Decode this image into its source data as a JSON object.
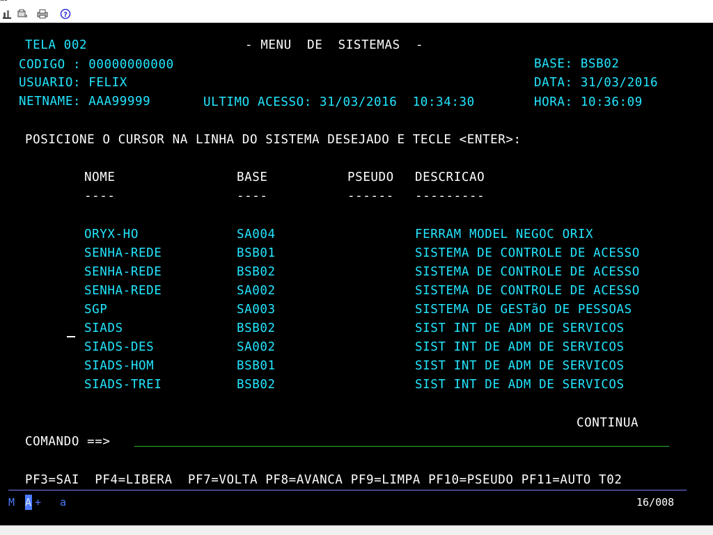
{
  "window": {
    "title_fragment": "ao"
  },
  "toolbar": {
    "icons": [
      "connect-icon",
      "print-setup-icon",
      "printer-icon",
      "help-icon"
    ]
  },
  "header": {
    "tela": "TELA 002",
    "menu_title": "- MENU  DE  SISTEMAS  -",
    "codigo": "CODIGO : 00000000000",
    "usuario": "USUARIO: FELIX",
    "netname": "NETNAME: AAA99999",
    "ultimo_acesso": "ULTIMO ACESSO: 31/03/2016  10:34:30",
    "base": "BASE: BSB02",
    "data": "DATA: 31/03/2016",
    "hora": "HORA: 10:36:09"
  },
  "instruction": "POSICIONE O CURSOR NA LINHA DO SISTEMA DESEJADO E TECLE <ENTER>:",
  "table": {
    "headers": [
      "NOME",
      "BASE",
      "PSEUDO",
      "DESCRICAO"
    ],
    "underlines": [
      "----",
      "----",
      "------",
      "---------"
    ],
    "rows": [
      {
        "nome": "ORYX-HO",
        "base": "SA004",
        "pseudo": "",
        "descricao": "FERRAM MODEL NEGOC ORIX"
      },
      {
        "nome": "SENHA-REDE",
        "base": "BSB01",
        "pseudo": "",
        "descricao": "SISTEMA DE CONTROLE DE ACESSO"
      },
      {
        "nome": "SENHA-REDE",
        "base": "BSB02",
        "pseudo": "",
        "descricao": "SISTEMA DE CONTROLE DE ACESSO"
      },
      {
        "nome": "SENHA-REDE",
        "base": "SA002",
        "pseudo": "",
        "descricao": "SISTEMA DE CONTROLE DE ACESSO"
      },
      {
        "nome": "SGP",
        "base": "SA003",
        "pseudo": "",
        "descricao": "SISTEMA DE GESTãO DE PESSOAS"
      },
      {
        "nome": "SIADS",
        "base": "BSB02",
        "pseudo": "",
        "descricao": "SIST INT DE ADM DE SERVICOS"
      },
      {
        "nome": "SIADS-DES",
        "base": "SA002",
        "pseudo": "",
        "descricao": "SIST INT DE ADM DE SERVICOS"
      },
      {
        "nome": "SIADS-HOM",
        "base": "BSB01",
        "pseudo": "",
        "descricao": "SIST INT DE ADM DE SERVICOS"
      },
      {
        "nome": "SIADS-TREI",
        "base": "BSB02",
        "pseudo": "",
        "descricao": "SIST INT DE ADM DE SERVICOS"
      }
    ]
  },
  "continua": "CONTINUA",
  "comando": {
    "label": "COMANDO ==>",
    "value": ""
  },
  "pf_keys": "PF3=SAI  PF4=LIBERA  PF7=VOLTA PF8=AVANCA PF9=LIMPA PF10=PSEUDO PF11=AUTO T02",
  "status": {
    "left_m": "M",
    "left_a": "A",
    "plus": "+",
    "indicator": "a",
    "cursor_pos": "16/008"
  },
  "colors": {
    "screen_bg": "#000000",
    "field_text": "#23e6ff",
    "highlight_text": "#ffffff",
    "input_line": "#2fb32f",
    "status_bar": "#7b7bff"
  }
}
